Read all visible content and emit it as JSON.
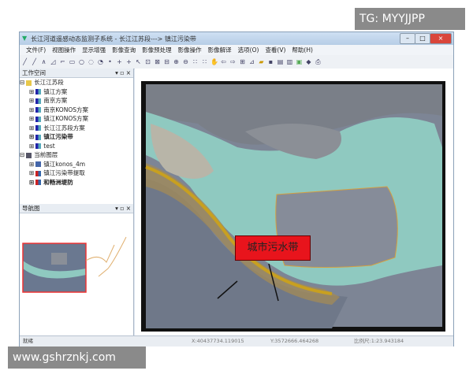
{
  "window": {
    "title": "长江河道遥感动态监测子系统 - 长江江苏段---> 镇江污染带",
    "controls": [
      "–",
      "□",
      "×"
    ]
  },
  "menu": [
    "文件(F)",
    "视图操作",
    "显示增强",
    "影像查询",
    "影像预处理",
    "影像操作",
    "影像解译",
    "选项(O)",
    "查看(V)",
    "帮助(H)"
  ],
  "workspace": {
    "title": "工作空间",
    "controls": "▾ ▫ ×",
    "root": "长江江苏段",
    "schemes": [
      "镇江方案",
      "南京方案",
      "南京KONOS方案",
      "镇江KONOS方案",
      "长江江苏段方案",
      "镇江污染带",
      "test"
    ],
    "layers_root": "当前图层",
    "layers": [
      "镇江konos_4m",
      "镇江污染带提取",
      "和畅洲堤防"
    ]
  },
  "navigator": {
    "title": "导航图",
    "controls": "▾ ▫ ×"
  },
  "map": {
    "annotation": "城市污水带",
    "annotation_color": "#e8141c",
    "water_color": "#8fc9c0"
  },
  "status": {
    "state": "就绪",
    "x": "X:40437734.119015",
    "y": "Y:3572666.464268",
    "scale": "比例尺:1:23.943184"
  },
  "watermarks": {
    "top": "TG: MYYJJPP",
    "bottom": "www.gshrznkj.com"
  }
}
